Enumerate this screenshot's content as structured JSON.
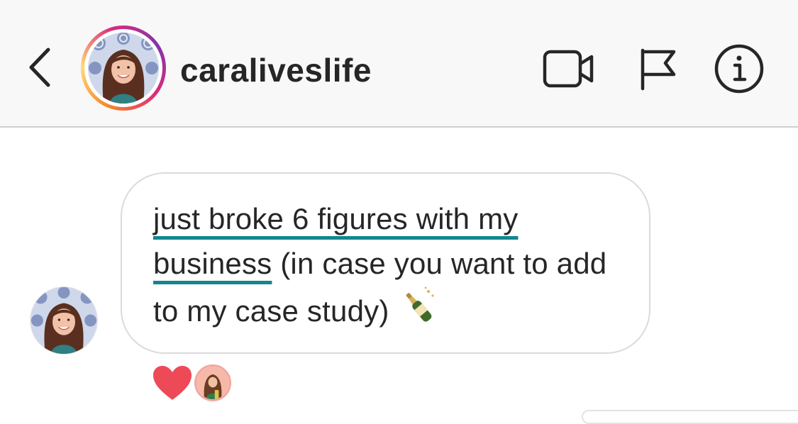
{
  "header": {
    "back_icon": "chevron-left-icon",
    "username": "caraliveslife",
    "actions": [
      {
        "name": "video-call",
        "icon": "video-camera-icon"
      },
      {
        "name": "report",
        "icon": "flag-icon"
      },
      {
        "name": "info",
        "icon": "info-icon"
      }
    ]
  },
  "message": {
    "text_part1": "just broke 6 figures with my",
    "text_part2": "business",
    "text_part3": " (in case you want to add to my case study) ",
    "emoji_icon": "champagne-bottle-icon",
    "reaction_icon": "heart-icon"
  },
  "colors": {
    "highlight_underline": "#13868f",
    "reaction_heart": "#ed4956",
    "text": "#262626"
  }
}
